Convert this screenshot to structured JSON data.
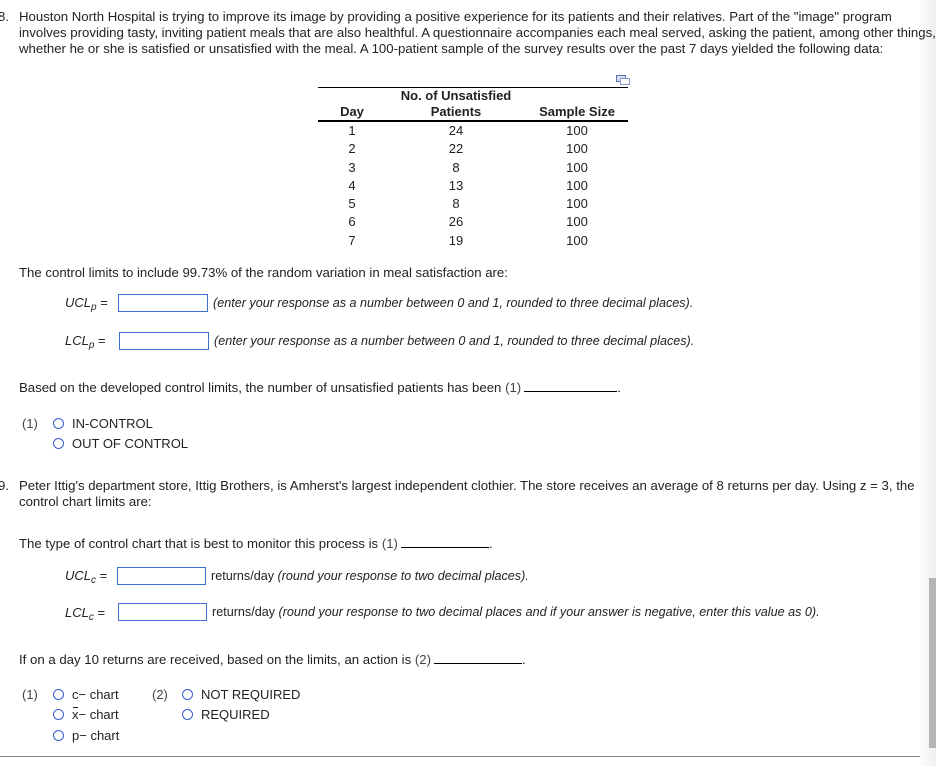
{
  "q8": {
    "number": "8.",
    "text_lines": [
      "Houston North Hospital is trying to improve its image by providing a positive experience for its patients and their relatives. Part of the \"image\" program",
      "involves providing tasty, inviting patient meals that are also healthful. A questionnaire accompanies each meal served, asking the patient, among other things,",
      "whether he or she is satisfied or unsatisfied with the meal. A 100-patient sample of the survey results over the past 7 days yielded the following data:"
    ],
    "table": {
      "headers": {
        "day": "Day",
        "unsatisfied_line1": "No. of Unsatisfied",
        "unsatisfied_line2": "Patients",
        "sample_size": "Sample Size"
      },
      "rows": [
        {
          "day": "1",
          "unsatisfied": "24",
          "sample_size": "100"
        },
        {
          "day": "2",
          "unsatisfied": "22",
          "sample_size": "100"
        },
        {
          "day": "3",
          "unsatisfied": "8",
          "sample_size": "100"
        },
        {
          "day": "4",
          "unsatisfied": "13",
          "sample_size": "100"
        },
        {
          "day": "5",
          "unsatisfied": "8",
          "sample_size": "100"
        },
        {
          "day": "6",
          "unsatisfied": "26",
          "sample_size": "100"
        },
        {
          "day": "7",
          "unsatisfied": "19",
          "sample_size": "100"
        }
      ],
      "popout_icon": "popout-window-icon"
    },
    "limits_intro": "The control limits to include 99.73% of the random variation in meal satisfaction are:",
    "ucl": {
      "label": "UCL",
      "sub": "p",
      "eq": "=",
      "value": "",
      "hint": "(enter your response as a number between 0 and 1, rounded to three decimal places)."
    },
    "lcl": {
      "label": "LCL",
      "sub": "p",
      "eq": "=",
      "value": "",
      "hint": "(enter your response as a number between 0 and 1, rounded to three decimal places)."
    },
    "conclusion": "Based on the developed control limits, the number of unsatisfied patients has been",
    "conclusion_ref": "(1)",
    "choices_label": "(1)",
    "choices": [
      "IN-CONTROL",
      "OUT OF CONTROL"
    ]
  },
  "q9": {
    "number": "9.",
    "text_line1": "Peter Ittig's department store, Ittig Brothers, is Amherst's largest independent clothier. The store receives an average of 8 returns per day.  Using z = 3, the",
    "text_line2": "control chart limits are:",
    "chart_type_text": "The type of control chart that is best to monitor this process is",
    "chart_type_ref": "(1)",
    "ucl": {
      "label": "UCL",
      "sub": "c",
      "eq": "=",
      "value": "",
      "unit": "returns/day",
      "hint": "(round your response to two decimal places)."
    },
    "lcl": {
      "label": "LCL",
      "sub": "c",
      "eq": "=",
      "value": "",
      "unit": "returns/day",
      "hint": "(round your response to two decimal places and if your answer is negative, enter this value as 0)."
    },
    "action_text": "If on a day 10 returns are received, based on the limits, an action is",
    "action_ref": "(2)",
    "group1_label": "(1)",
    "group1_choices": [
      {
        "prefix": "c",
        "suffix": " − chart"
      },
      {
        "prefix": "x",
        "suffix": " − chart",
        "overbar": true
      },
      {
        "prefix": "p",
        "suffix": " − chart"
      }
    ],
    "group2_label": "(2)",
    "group2_choices": [
      "NOT REQUIRED",
      "REQUIRED"
    ]
  }
}
